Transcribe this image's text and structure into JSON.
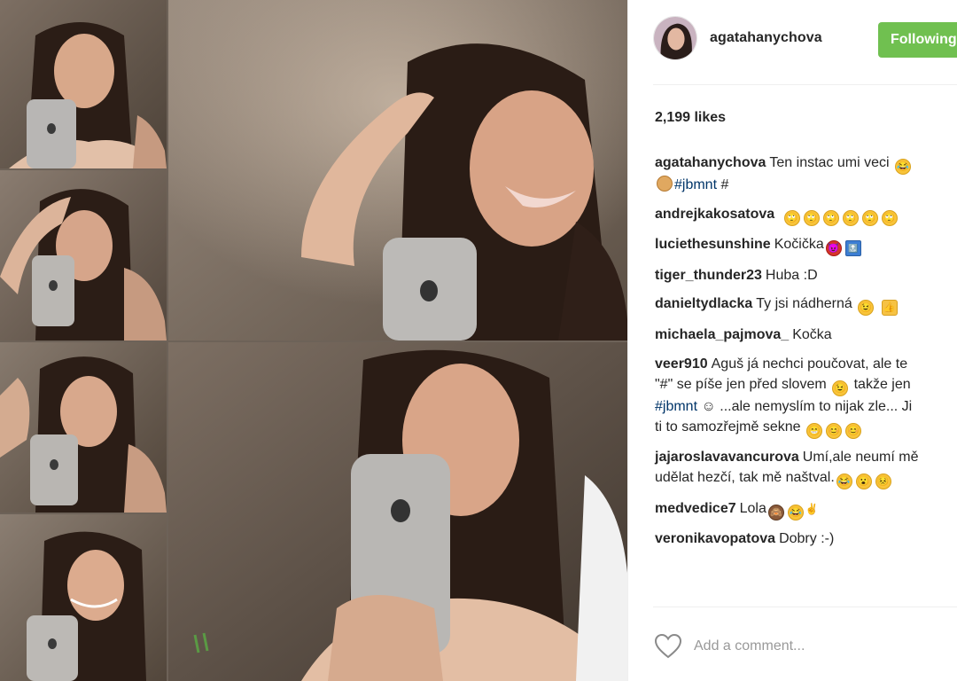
{
  "post": {
    "username": "agatahanychova",
    "follow_label": "Following",
    "likes": "2,199 likes",
    "add_comment_placeholder": "Add a comment..."
  },
  "comments": [
    {
      "user": "agatahanychova",
      "text": "Ten instac umi veci",
      "line2_tag": "#jbmnt",
      "line2_suffix": "#"
    },
    {
      "user": "andrejkakosatova",
      "text": ""
    },
    {
      "user": "luciethesunshine",
      "text": "Kočička"
    },
    {
      "user": "tiger_thunder23",
      "text": "Huba :D"
    },
    {
      "user": "danieltydlacka",
      "text": "Ty jsi nádherná"
    },
    {
      "user": "michaela_pajmova_",
      "text": "Kočka"
    },
    {
      "user": "veer910",
      "text": "Aguš já nechci poučovat, ale te",
      "line2": "\"#\" se píše jen před slovem",
      "line2_suffix": "takže jen",
      "line3_tag": "#jbmnt",
      "line3": "☺ ...ale nemyslím to nijak zle... Ji",
      "line4": "ti to samozřejmě sekne"
    },
    {
      "user": "jajaroslavavancurova",
      "text": "Umí,ale neumí mě",
      "line2": "udělat hezčí, tak mě naštval."
    },
    {
      "user": "medvedice7",
      "text": "Lola"
    },
    {
      "user": "veronikavopatova",
      "text": "Dobry :-)"
    }
  ],
  "colors": {
    "follow_button": "#70c050",
    "hashtag": "#003569",
    "username": "#262626",
    "placeholder": "#999999"
  },
  "icons": [
    "heart-icon",
    "apple-logo-icon",
    "emoji-icon"
  ]
}
